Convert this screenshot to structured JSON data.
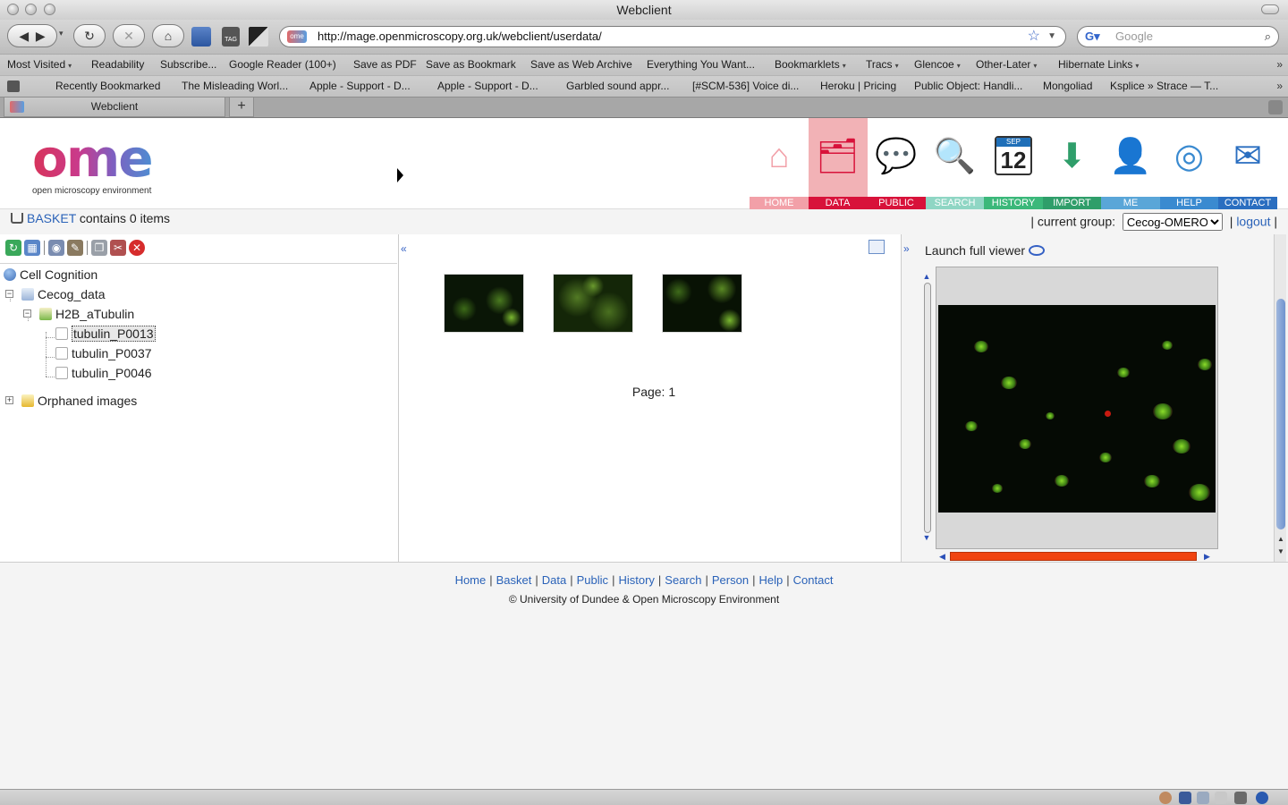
{
  "window": {
    "title": "Webclient"
  },
  "navigation": {
    "url": "http://mage.openmicroscopy.org.uk/webclient/userdata/",
    "search_placeholder": "Google"
  },
  "bookmarks_bar": [
    {
      "label": "Most Visited",
      "menu": true
    },
    {
      "label": "Readability",
      "menu": false
    },
    {
      "label": "Subscribe...",
      "menu": false
    },
    {
      "label": "Google Reader (100+)",
      "menu": false
    },
    {
      "label": "Save as PDF",
      "menu": false
    },
    {
      "label": "Save as Bookmark",
      "menu": false
    },
    {
      "label": "Save as Web Archive",
      "menu": false
    },
    {
      "label": "Everything You Want...",
      "menu": false
    },
    {
      "label": "Bookmarklets",
      "menu": true
    },
    {
      "label": "Tracs",
      "menu": true
    },
    {
      "label": "Glencoe",
      "menu": true
    },
    {
      "label": "Other-Later",
      "menu": true
    },
    {
      "label": "Hibernate Links",
      "menu": true
    }
  ],
  "recent_bar": [
    "Recently Bookmarked",
    "The Misleading Worl...",
    "Apple - Support - D...",
    "Apple - Support - D...",
    "Garbled sound appr...",
    "[#SCM-536] Voice di...",
    "Heroku | Pricing",
    "Public Object: Handli...",
    "Mongoliad",
    "Ksplice » Strace — T..."
  ],
  "tabs": [
    {
      "label": "Webclient",
      "active": true
    }
  ],
  "logo": {
    "big": "ome",
    "sub": "open microscopy environment"
  },
  "top_nav": [
    {
      "label": "HOME",
      "color": "#f2a0a8",
      "icon": "home-icon",
      "glyph": "⌂"
    },
    {
      "label": "DATA",
      "color": "#d8123a",
      "icon": "data-icon",
      "glyph": "🗂",
      "active": true
    },
    {
      "label": "PUBLIC",
      "color": "#d8123a",
      "icon": "public-icon",
      "glyph": "💬"
    },
    {
      "label": "SEARCH",
      "color": "#8fd6c4",
      "icon": "search-icon",
      "glyph": "🔍"
    },
    {
      "label": "HISTORY",
      "color": "#3bb87a",
      "icon": "history-icon",
      "glyph": "12"
    },
    {
      "label": "IMPORT",
      "color": "#2f9e6a",
      "icon": "import-icon",
      "glyph": "⬇"
    },
    {
      "label": "ME",
      "color": "#5aa6d8",
      "icon": "me-icon",
      "glyph": "👤"
    },
    {
      "label": "HELP",
      "color": "#3a8ad0",
      "icon": "help-icon",
      "glyph": "◎"
    },
    {
      "label": "CONTACT",
      "color": "#2a6ec0",
      "icon": "contact-icon",
      "glyph": "✉"
    }
  ],
  "history_icon_month": "SEP",
  "basket": {
    "link": "BASKET",
    "text": "contains 0 items"
  },
  "group": {
    "label": "| current group:",
    "selected": "Cecog-OMERO",
    "logout": "logout",
    "sep_left": "|",
    "sep_right": "|"
  },
  "tree": {
    "root": "Cell Cognition",
    "project": "Cecog_data",
    "dataset": "H2B_aTubulin",
    "images": [
      "tubulin_P0013",
      "tubulin_P0037",
      "tubulin_P0046"
    ],
    "orphaned": "Orphaned images"
  },
  "center": {
    "collapse": "«",
    "page_label": "Page: 1"
  },
  "right": {
    "expand": "»",
    "launch": "Launch full viewer"
  },
  "footer": {
    "links": [
      "Home",
      "Basket",
      "Data",
      "Public",
      "History",
      "Search",
      "Person",
      "Help",
      "Contact"
    ],
    "separator": "|",
    "copyright": "© University of Dundee & Open Microscopy Environment"
  }
}
